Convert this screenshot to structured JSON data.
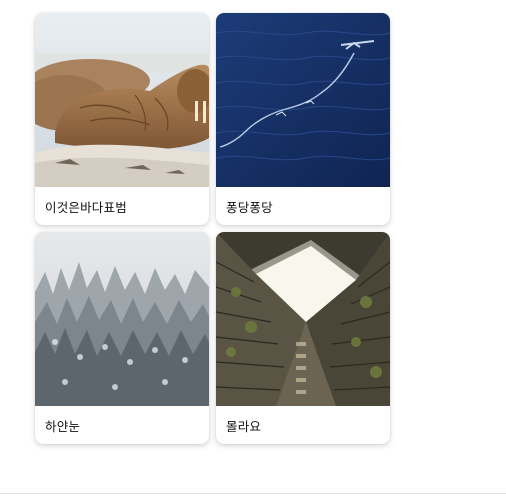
{
  "gallery": {
    "cards": [
      {
        "title": "이것은바다표범",
        "image": "walrus-photo"
      },
      {
        "title": "퐁당퐁당",
        "image": "ocean-water-photo"
      },
      {
        "title": "하얀눈",
        "image": "snowy-forest-photo"
      },
      {
        "title": "몰라요",
        "image": "building-courtyard-photo"
      }
    ]
  }
}
